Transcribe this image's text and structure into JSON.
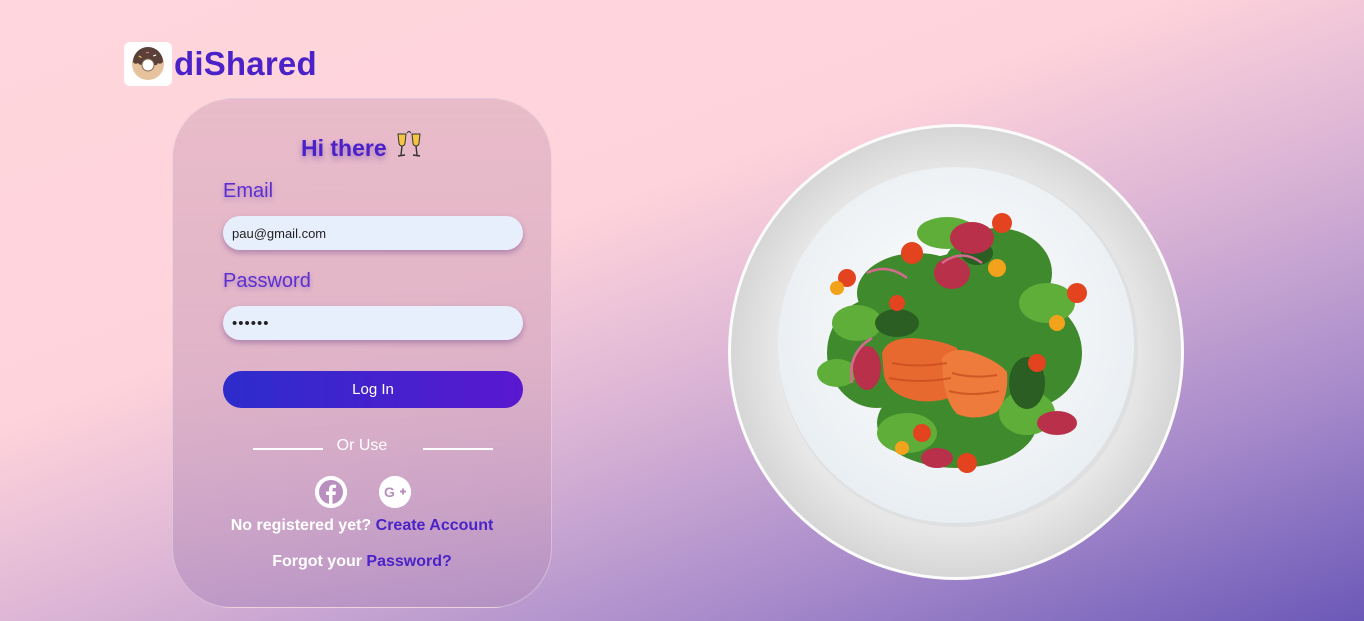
{
  "brand": {
    "name": "diShared",
    "logo_icon": "donut-logo-icon"
  },
  "card": {
    "greeting": "Hi there",
    "greeting_icon": "clinking-glasses-icon",
    "email_label": "Email",
    "email_value": "pau@gmail.com",
    "password_label": "Password",
    "password_value": "••••••",
    "login_label": "Log In",
    "or_use": "Or Use",
    "social": [
      "facebook-icon",
      "google-plus-icon"
    ],
    "register_prompt": "No registered yet?",
    "register_link": "Create Account",
    "forgot_prompt": "Forgot your",
    "forgot_link": "Password?"
  },
  "hero": {
    "image": "salmon-salad-plate"
  },
  "colors": {
    "accent": "#4a22c8",
    "button_start": "#2d2ccb",
    "button_end": "#5a18cf",
    "input_bg": "#e8effc"
  }
}
